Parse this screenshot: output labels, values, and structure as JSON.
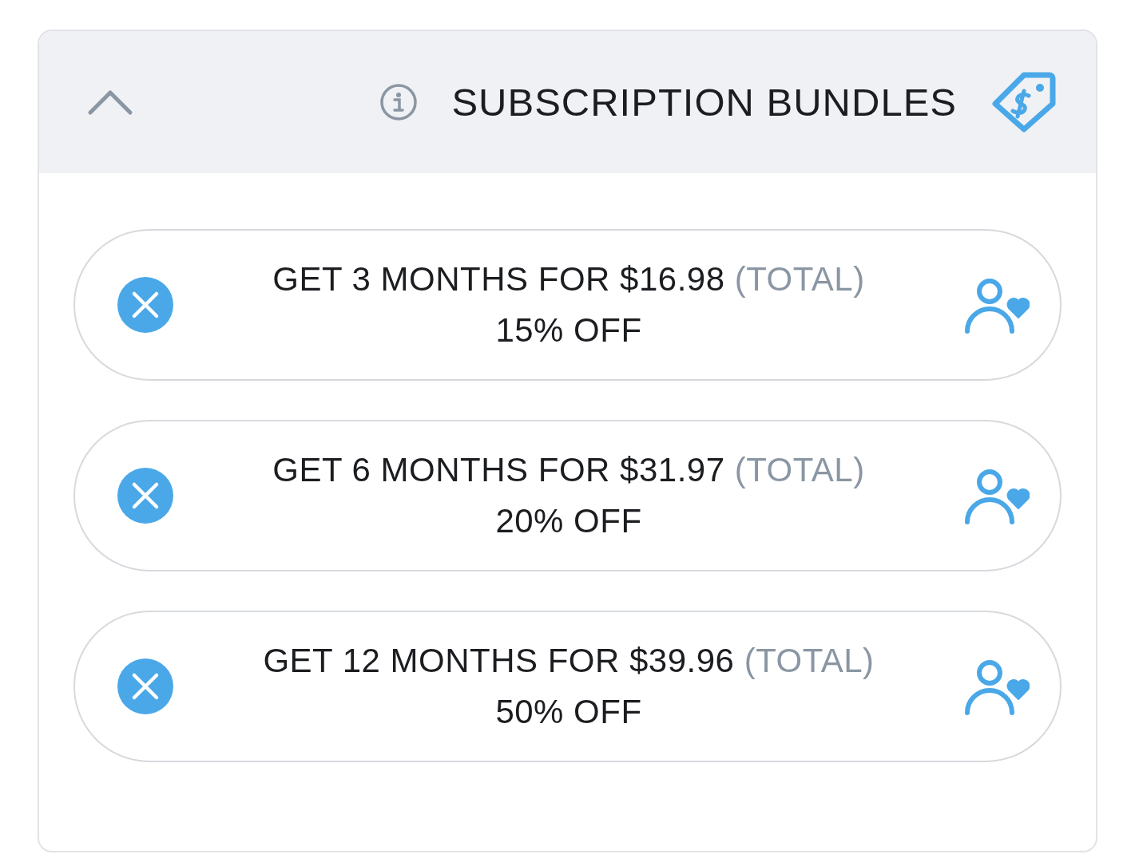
{
  "panel": {
    "title": "SUBSCRIPTION BUNDLES",
    "expanded": true
  },
  "bundles": [
    {
      "offer": "GET 3 MONTHS FOR $16.98",
      "note": "(TOTAL)",
      "discount": "15% OFF"
    },
    {
      "offer": "GET 6 MONTHS FOR $31.97",
      "note": "(TOTAL)",
      "discount": "20% OFF"
    },
    {
      "offer": "GET 12 MONTHS FOR $39.96",
      "note": "(TOTAL)",
      "discount": "50% OFF"
    }
  ]
}
